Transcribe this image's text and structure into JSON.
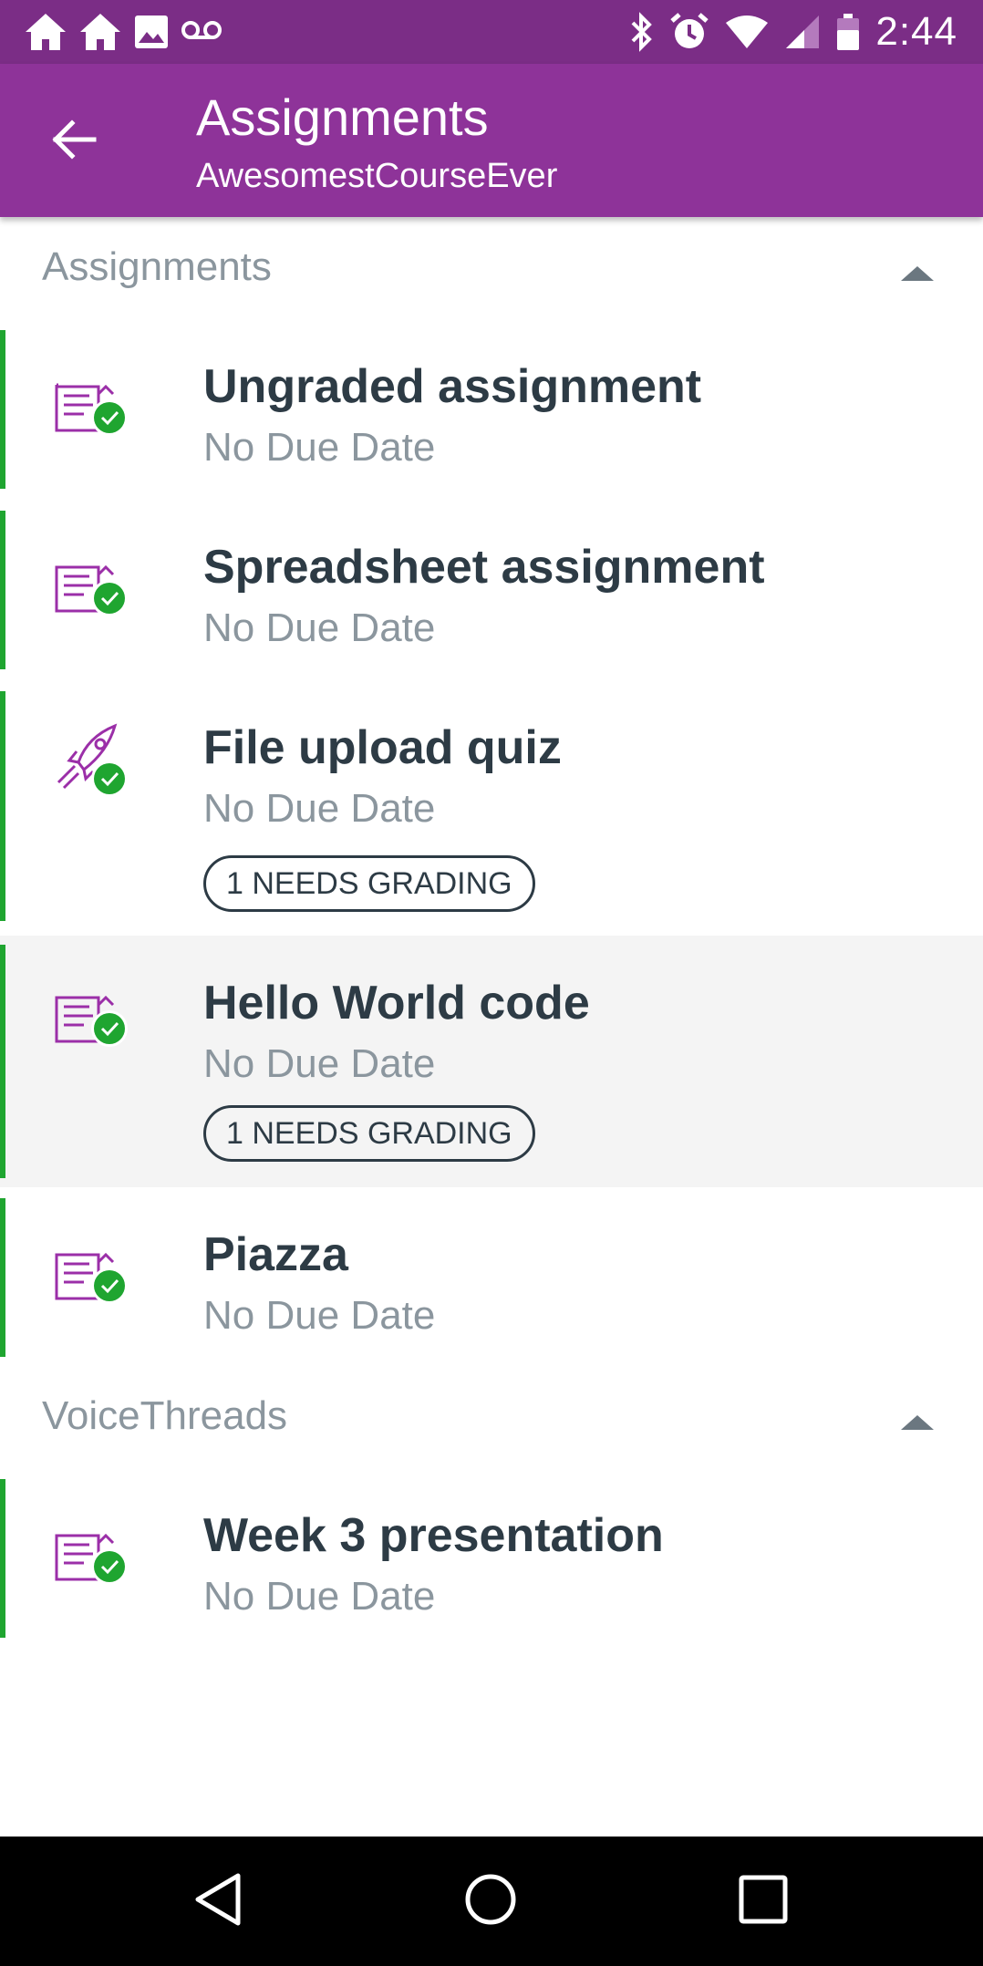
{
  "status_bar": {
    "time": "2:44",
    "left_icons": [
      "home-icon",
      "home-icon",
      "image-icon",
      "voicemail-icon"
    ],
    "right_icons": [
      "bluetooth-icon",
      "alarm-icon",
      "wifi-icon",
      "signal-icon",
      "battery-icon"
    ]
  },
  "toolbar": {
    "title": "Assignments",
    "subtitle": "AwesomestCourseEver",
    "back_icon": "arrow-back-icon"
  },
  "colors": {
    "status_bar": "#7B2D86",
    "toolbar": "#8E3399",
    "accent_bar": "#1FA530",
    "icon_purple": "#9B2FA8",
    "check_green": "#1FA530",
    "title_text": "#2D3B45",
    "secondary_text": "#8B969E"
  },
  "sections": [
    {
      "title": "Assignments",
      "items": [
        {
          "title": "Ungraded assignment",
          "due": "No Due Date",
          "icon": "assignment-icon",
          "badge": ""
        },
        {
          "title": "Spreadsheet assignment",
          "due": "No Due Date",
          "icon": "assignment-icon",
          "badge": ""
        },
        {
          "title": "File upload quiz",
          "due": "No Due Date",
          "icon": "quiz-rocket-icon",
          "badge": "1 NEEDS GRADING"
        },
        {
          "title": "Hello World code",
          "due": "No Due Date",
          "icon": "assignment-icon",
          "badge": "1 NEEDS GRADING",
          "selected": true
        },
        {
          "title": "Piazza",
          "due": "No Due Date",
          "icon": "assignment-icon",
          "badge": ""
        }
      ]
    },
    {
      "title": "VoiceThreads",
      "items": [
        {
          "title": "Week 3 presentation",
          "due": "No Due Date",
          "icon": "assignment-icon",
          "badge": ""
        }
      ]
    }
  ],
  "nav_bar": {
    "icons": [
      "back-triangle-icon",
      "home-circle-icon",
      "recents-square-icon"
    ]
  }
}
